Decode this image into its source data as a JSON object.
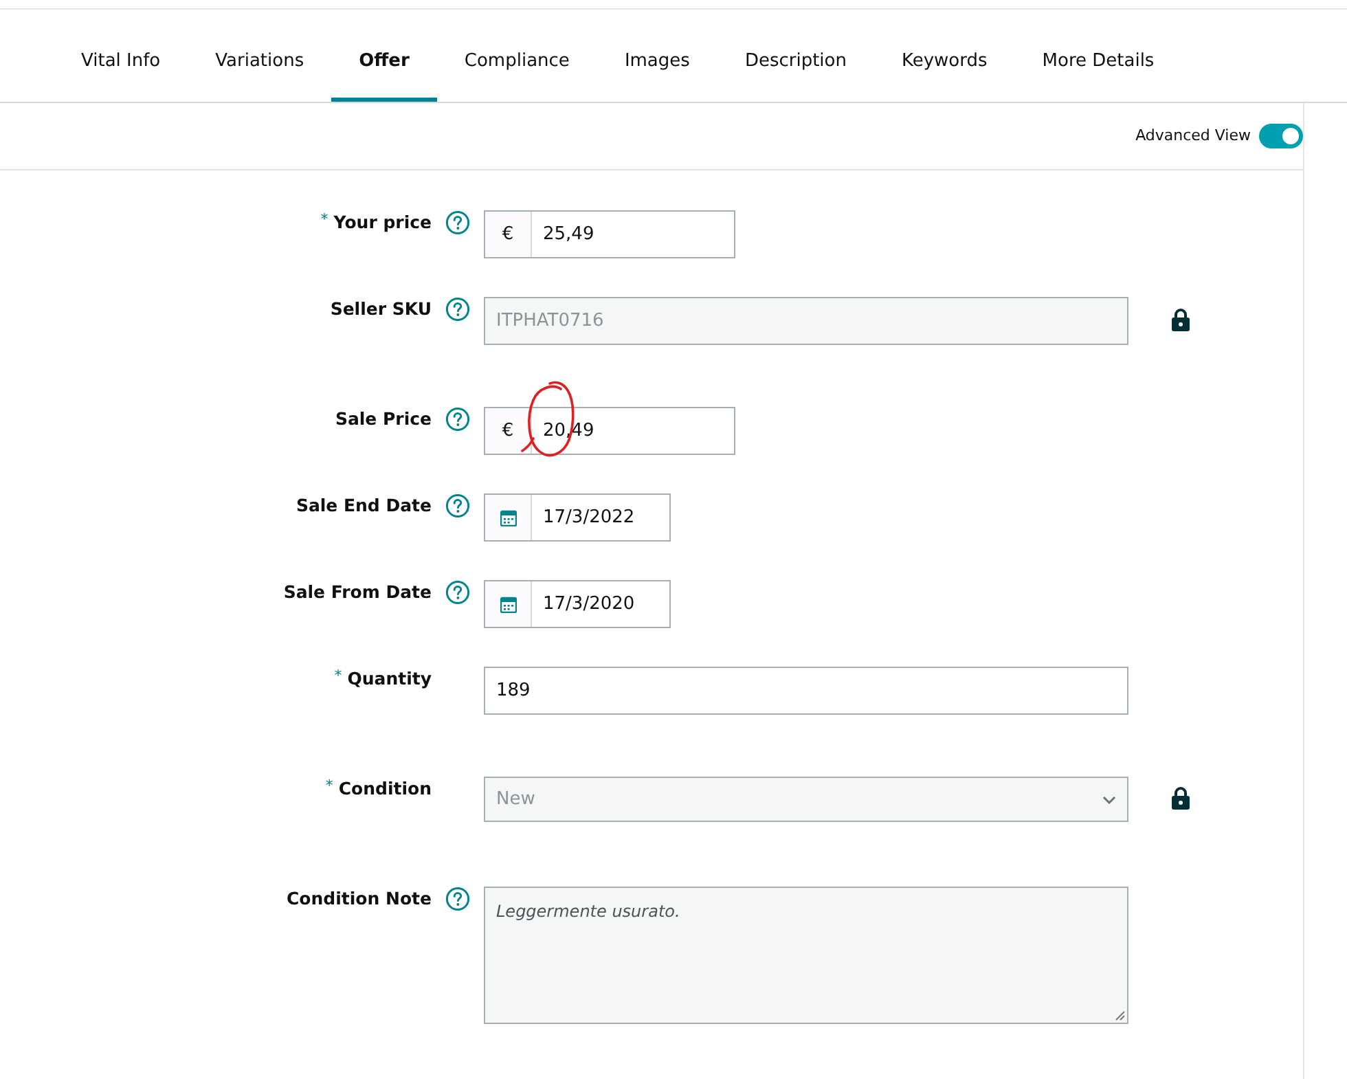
{
  "tabs": [
    {
      "label": "Vital Info",
      "selected": false
    },
    {
      "label": "Variations",
      "selected": false
    },
    {
      "label": "Offer",
      "selected": true
    },
    {
      "label": "Compliance",
      "selected": false
    },
    {
      "label": "Images",
      "selected": false
    },
    {
      "label": "Description",
      "selected": false
    },
    {
      "label": "Keywords",
      "selected": false
    },
    {
      "label": "More Details",
      "selected": false
    }
  ],
  "advanced_view": {
    "label": "Advanced View",
    "on": true
  },
  "fields": [
    {
      "kind": "currency",
      "label": "Your price",
      "required_mark": "*",
      "help": true,
      "prefix": "€",
      "value": "25,49",
      "disabled": false,
      "locked": false,
      "annotated": false
    },
    {
      "kind": "text",
      "label": "Seller SKU",
      "help": true,
      "value": "ITPHAT0716",
      "disabled": true,
      "locked": true,
      "annotated": false
    },
    {
      "kind": "currency",
      "label": "Sale Price",
      "help": true,
      "prefix": "€",
      "value": "20,49",
      "disabled": false,
      "locked": false,
      "annotated": true
    },
    {
      "kind": "date",
      "label": "Sale End Date",
      "help": true,
      "value": "17/3/2022",
      "disabled": false,
      "locked": false,
      "annotated": false
    },
    {
      "kind": "date",
      "label": "Sale From Date",
      "help": true,
      "value": "17/3/2020",
      "disabled": false,
      "locked": false,
      "annotated": false
    },
    {
      "kind": "text",
      "label": "Quantity",
      "required_mark": "*",
      "help": false,
      "value": "189",
      "disabled": false,
      "locked": false,
      "annotated": false
    },
    {
      "kind": "select",
      "label": "Condition",
      "required_mark": "*",
      "help": false,
      "value": "New",
      "disabled": true,
      "locked": true,
      "annotated": false
    },
    {
      "kind": "textarea",
      "label": "Condition Note",
      "help": true,
      "value": "Leggermente usurato.",
      "disabled": true,
      "locked": false,
      "annotated": false
    }
  ]
}
